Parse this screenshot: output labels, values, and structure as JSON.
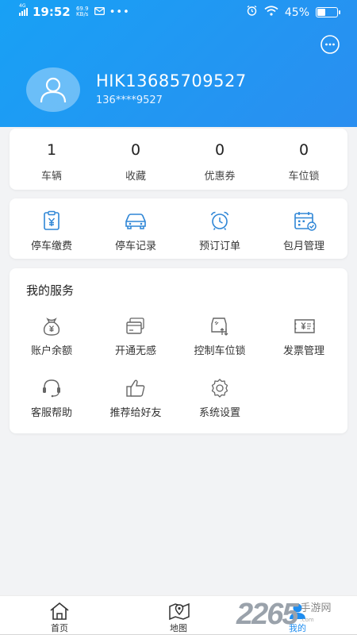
{
  "status_bar": {
    "time": "19:52",
    "network_speed": "69.9",
    "network_unit": "KB/s",
    "signal_label": "4G",
    "battery": "45%",
    "battery_level": 0.45
  },
  "profile": {
    "name": "HIK13685709527",
    "phone": "136****9527"
  },
  "stats": [
    {
      "value": "1",
      "label": "车辆"
    },
    {
      "value": "0",
      "label": "收藏"
    },
    {
      "value": "0",
      "label": "优惠券"
    },
    {
      "value": "0",
      "label": "车位锁"
    }
  ],
  "quick_actions": [
    {
      "label": "停车缴费",
      "icon": "parking-fee-icon"
    },
    {
      "label": "停车记录",
      "icon": "car-icon"
    },
    {
      "label": "预订订单",
      "icon": "alarm-clock-icon"
    },
    {
      "label": "包月管理",
      "icon": "calendar-icon"
    }
  ],
  "services": {
    "title": "我的服务",
    "items": [
      {
        "label": "账户余额",
        "icon": "money-bag-icon"
      },
      {
        "label": "开通无感",
        "icon": "card-icon"
      },
      {
        "label": "控制车位锁",
        "icon": "parking-lock-icon"
      },
      {
        "label": "发票管理",
        "icon": "invoice-icon"
      },
      {
        "label": "客服帮助",
        "icon": "headset-icon"
      },
      {
        "label": "推荐给好友",
        "icon": "thumbs-up-icon"
      },
      {
        "label": "系统设置",
        "icon": "gear-icon"
      }
    ]
  },
  "bottom_nav": [
    {
      "label": "首页",
      "icon": "home-icon"
    },
    {
      "label": "地图",
      "icon": "map-icon"
    },
    {
      "label": "我的",
      "icon": "user-icon"
    }
  ],
  "watermark": {
    "number": "2265",
    "text": "手游网",
    "sub": ".com"
  },
  "colors": {
    "primary": "#1e8df0",
    "icon_blue": "#2f86d6",
    "icon_gray": "#666666"
  }
}
